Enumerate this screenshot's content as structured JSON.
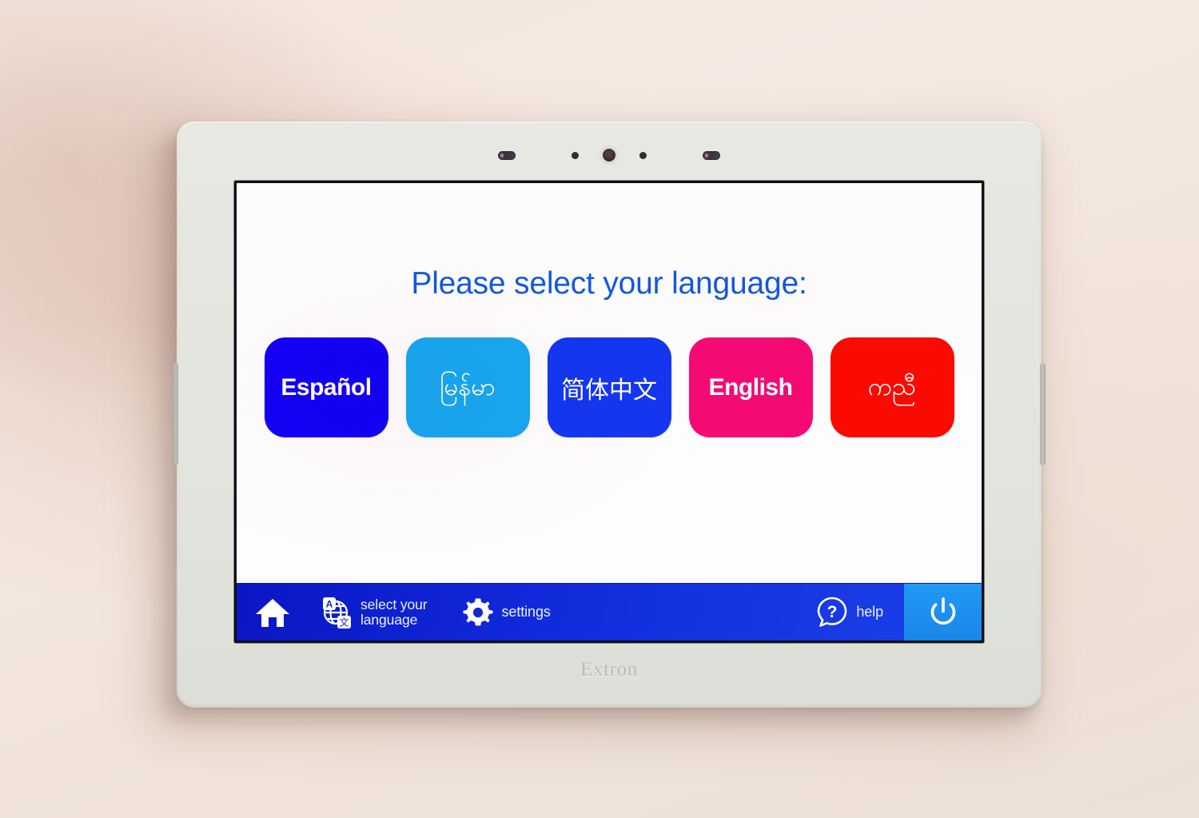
{
  "device": {
    "brand": "Extron",
    "bezel_color": "#e4e6df",
    "sensors": [
      "proximity-sensor-left",
      "light-sensor-dot-left",
      "camera-lens",
      "light-sensor-dot-right",
      "proximity-sensor-right"
    ]
  },
  "screen": {
    "title": "Please select your language:",
    "title_color": "#1358e2",
    "background_color": "#ffffff",
    "languages": [
      {
        "label": "Español",
        "script": "latin",
        "color": "#1400f5",
        "name": "spanish"
      },
      {
        "label": "မြန်မာ",
        "script": "myanmar",
        "color": "#18a8f0",
        "name": "burmese"
      },
      {
        "label": "简体中文",
        "script": "cjk",
        "color": "#1436f0",
        "name": "simplified-chinese"
      },
      {
        "label": "English",
        "script": "latin",
        "color": "#f50a73",
        "name": "english"
      },
      {
        "label": "ကညီ",
        "script": "myanmar",
        "color": "#fa0a00",
        "name": "karen"
      }
    ],
    "toolbar": {
      "background_color": "#1228d4",
      "home_label": "",
      "select_language_line1": "select your",
      "select_language_line2": "language",
      "settings_label": "settings",
      "help_label": "help",
      "power_color": "#1d91ef"
    }
  }
}
